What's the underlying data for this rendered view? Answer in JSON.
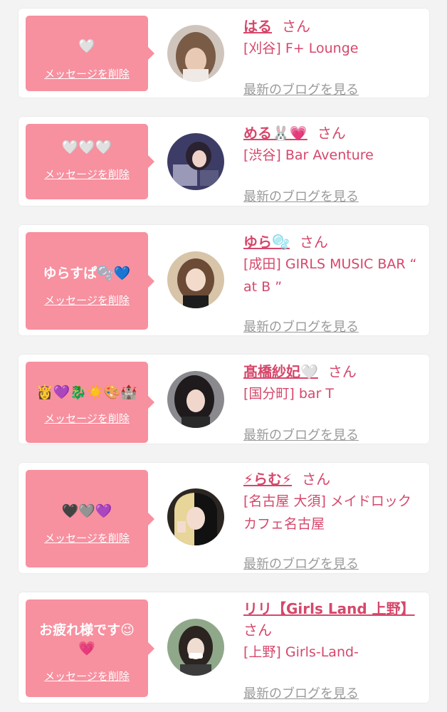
{
  "delete_label": "メッセージを削除",
  "honorific": "さん",
  "blog_label": "最新のブログを見る",
  "colors": {
    "background": "#f3f3f3",
    "card": "#ffffff",
    "bubble": "#f7909f",
    "name": "#d6476b",
    "link_gray": "#9a9a9a"
  },
  "messages": [
    {
      "bubble_text": "🤍",
      "name": "はる",
      "shop": "[刈谷] F+ Lounge",
      "avatar_icon": "photo-avatar"
    },
    {
      "bubble_text": "🤍🤍🤍",
      "name": "める🐰💗",
      "shop": "[渋谷] Bar Aventure",
      "avatar_icon": "photo-avatar"
    },
    {
      "bubble_text": "ゆらすぱ🫧💙",
      "name": "ゆら🫧",
      "shop": "[成田] GIRLS MUSIC BAR “ at B ”",
      "avatar_icon": "photo-avatar"
    },
    {
      "bubble_text": "👸💜🐉☀️🎨🏰",
      "name": "髙橋紗妃🤍",
      "shop": "[国分町] bar T",
      "avatar_icon": "photo-avatar"
    },
    {
      "bubble_text": "🖤🩶💜",
      "name": "⚡らむ⚡",
      "shop": "[名古屋 大須] メイドロックカフェ名古屋",
      "avatar_icon": "photo-avatar"
    },
    {
      "bubble_text": "お疲れ様です😉\n💗",
      "name": "リリ【Girls Land 上野】",
      "shop": "[上野] Girls-Land-",
      "avatar_icon": "photo-avatar"
    }
  ]
}
